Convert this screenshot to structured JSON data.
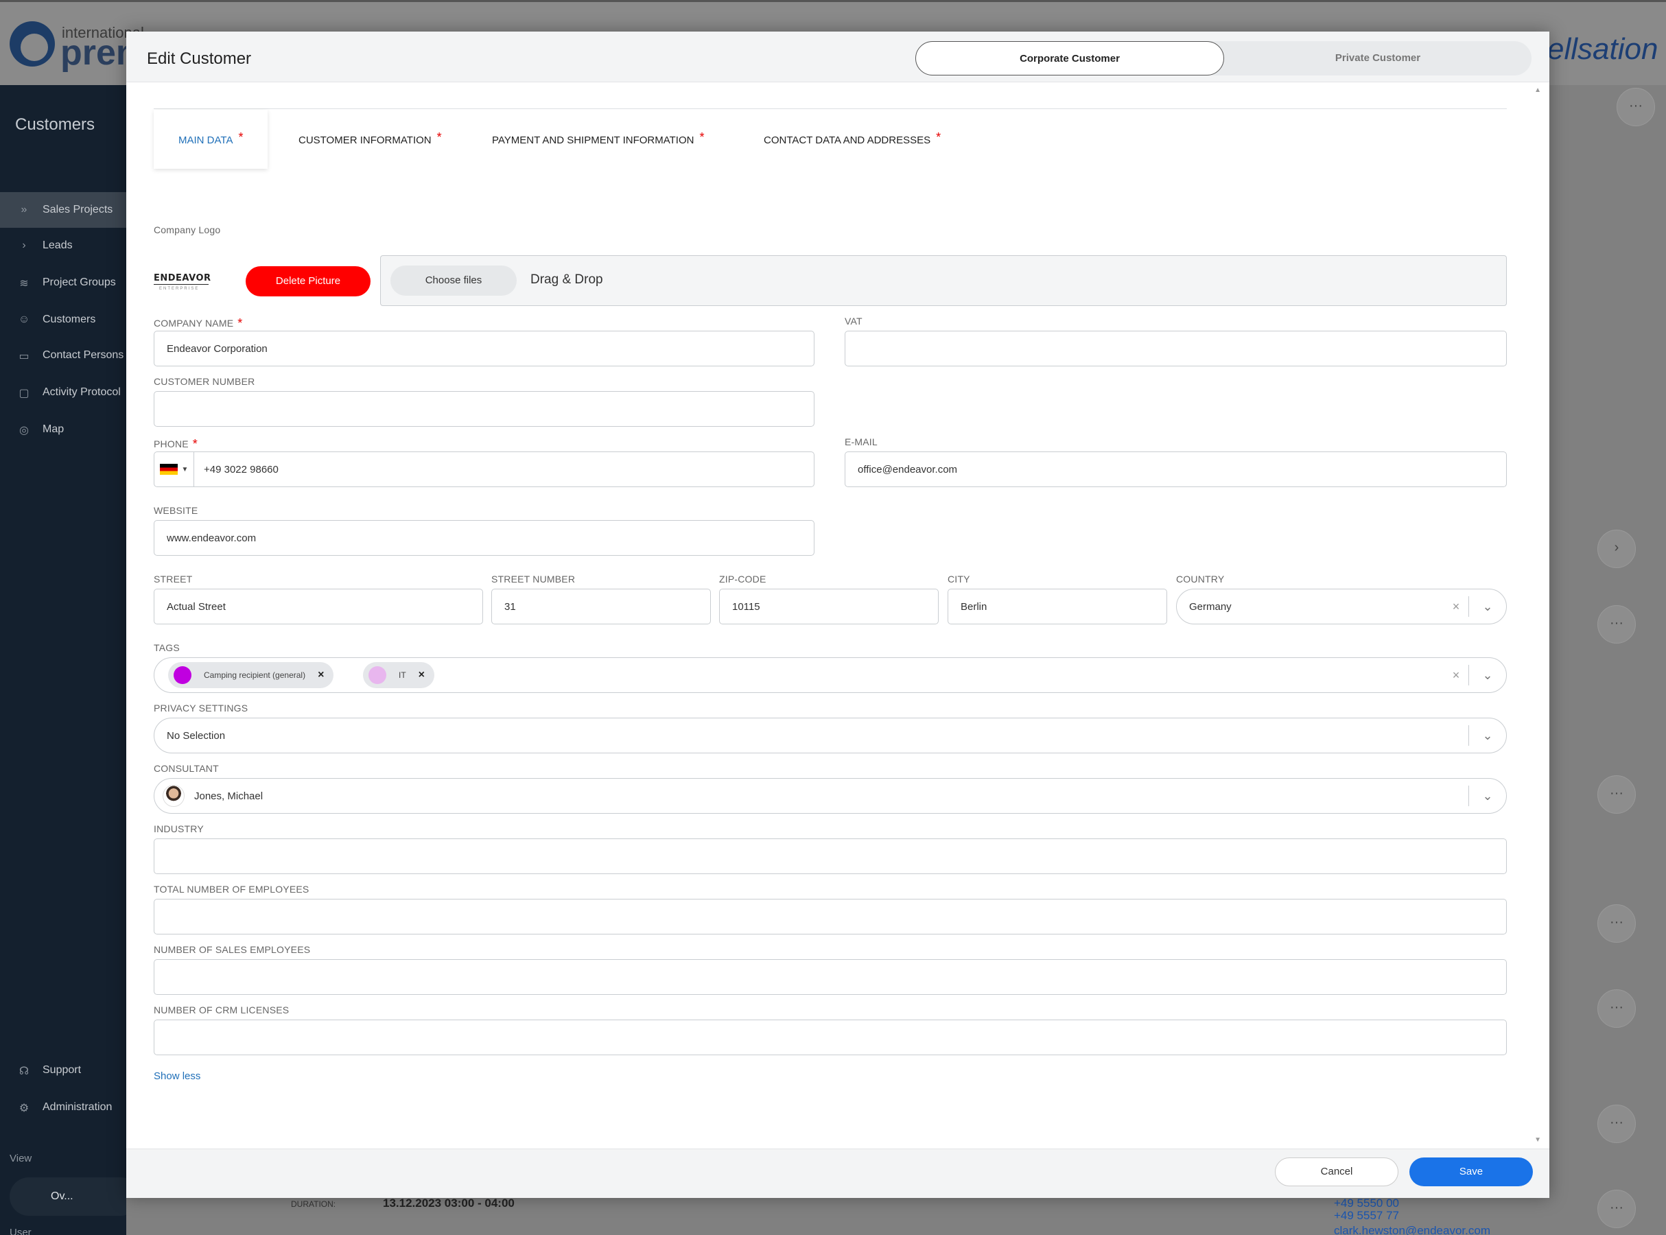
{
  "background": {
    "logo_small": "international",
    "logo_big": "prem",
    "brand": "ellsation",
    "sidebar_title": "Customers",
    "nav": [
      {
        "label": "Sales Projects",
        "icon": "chevrons-right-icon",
        "active": true
      },
      {
        "label": "Leads",
        "icon": "chevron-right-icon",
        "active": false
      },
      {
        "label": "Project Groups",
        "icon": "layers-icon",
        "active": false
      },
      {
        "label": "Customers",
        "icon": "users-icon",
        "active": false
      },
      {
        "label": "Contact Persons",
        "icon": "id-card-icon",
        "active": false
      },
      {
        "label": "Activity Protocol",
        "icon": "comment-icon",
        "active": false
      },
      {
        "label": "Map",
        "icon": "globe-icon",
        "active": false
      }
    ],
    "support": "Support",
    "administration": "Administration",
    "view_label": "View",
    "view_value": "Ov...",
    "user_label": "User",
    "duration_label": "DURATION:",
    "duration_value": "13.12.2023 03:00 - 04:00",
    "phone_1": "+49 5550 00",
    "phone_2": "+49 5557 77",
    "email_link": "clark.hewston@endeavor.com"
  },
  "modal": {
    "title": "Edit Customer",
    "customer_types": [
      "Corporate Customer",
      "Private Customer"
    ],
    "selected_type": "Corporate Customer",
    "tabs": [
      {
        "label": "MAIN DATA",
        "required": "*",
        "active": true
      },
      {
        "label": "CUSTOMER INFORMATION",
        "required": "*",
        "active": false
      },
      {
        "label": "PAYMENT AND SHIPMENT INFORMATION",
        "required": "*",
        "active": false
      },
      {
        "label": "CONTACT DATA AND ADDRESSES",
        "required": "*",
        "active": false
      }
    ],
    "company_logo": {
      "label": "Company Logo",
      "logo_text": "ENDEAVOR",
      "logo_subtext": "ENTERPRISE",
      "delete_button": "Delete Picture",
      "choose_button": "Choose files",
      "drop_text": "Drag & Drop"
    },
    "fields": {
      "company_name": {
        "label": "COMPANY NAME",
        "value": "Endeavor Corporation",
        "required": "*"
      },
      "vat": {
        "label": "VAT",
        "value": ""
      },
      "customer_number": {
        "label": "CUSTOMER NUMBER",
        "value": ""
      },
      "phone": {
        "label": "PHONE",
        "value": "+49 3022 98660",
        "required": "*",
        "country_code": "DE"
      },
      "email": {
        "label": "E-MAIL",
        "value": "office@endeavor.com"
      },
      "website": {
        "label": "WEBSITE",
        "value": "www.endeavor.com"
      },
      "street": {
        "label": "STREET",
        "value": "Actual Street"
      },
      "street_number": {
        "label": "STREET NUMBER",
        "value": "31"
      },
      "zip": {
        "label": "ZIP-CODE",
        "value": "10115"
      },
      "city": {
        "label": "CITY",
        "value": "Berlin"
      },
      "country": {
        "label": "COUNTRY",
        "value": "Germany"
      },
      "tags": {
        "label": "TAGS",
        "items": [
          {
            "label": "Camping recipient (general)",
            "color": "#c000e0"
          },
          {
            "label": "IT",
            "color": "#e8b6ee"
          }
        ]
      },
      "privacy": {
        "label": "PRIVACY SETTINGS",
        "value": "No Selection"
      },
      "consultant": {
        "label": "CONSULTANT",
        "value": "Jones, Michael"
      },
      "industry": {
        "label": "INDUSTRY",
        "value": ""
      },
      "total_employees": {
        "label": "TOTAL NUMBER OF EMPLOYEES",
        "value": ""
      },
      "sales_employees": {
        "label": "NUMBER OF SALES EMPLOYEES",
        "value": ""
      },
      "crm_licenses": {
        "label": "NUMBER OF CRM LICENSES",
        "value": ""
      }
    },
    "show_less": "Show less",
    "cancel": "Cancel",
    "save": "Save"
  },
  "colors": {
    "accent": "#1a73e8",
    "danger": "#ff0000",
    "required": "#e60000",
    "sidebar": "#14202e"
  }
}
